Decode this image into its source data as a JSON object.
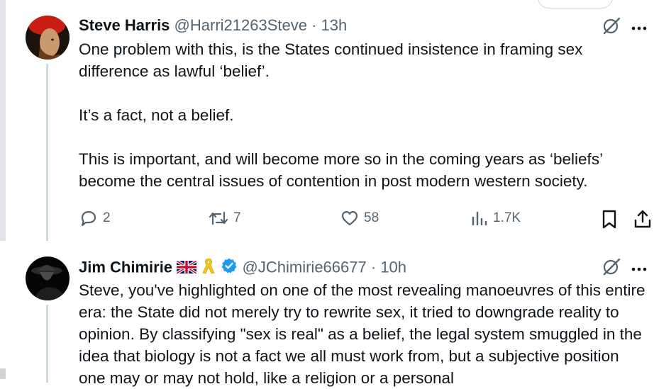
{
  "tweets": [
    {
      "name": "Steve Harris",
      "handle": "@Harri21263Steve",
      "separator": "·",
      "time": "13h",
      "text": "One problem with this, is the States continued insistence in framing sex difference as lawful ‘belief’.\n\nIt’s a fact, not a belief.\n\nThis is important, and will become more so in the coming years as ‘beliefs’ become the central issues of contention in post modern western society.",
      "replies": "2",
      "reposts": "7",
      "likes": "58",
      "views": "1.7K"
    },
    {
      "name": "Jim Chimirie",
      "handle": "@JChimirie66677",
      "separator": "·",
      "time": "10h",
      "text": "Steve, you've highlighted on one of the most revealing manoeuvres of this entire era: the State did not merely try to rewrite sex, it tried to downgrade reality to opinion. By classifying \"sex is real\" as a belief, the legal system smuggled in the idea that biology is not a fact we all must work from, but a subjective position one may or may not hold, like a religion or a personal"
    }
  ],
  "icons": {
    "grok": "grok-icon",
    "more": "more-icon",
    "reply": "reply-icon",
    "repost": "repost-icon",
    "like": "heart-icon",
    "views": "views-icon",
    "bookmark": "bookmark-icon",
    "share": "share-icon",
    "flag": "uk-flag-icon",
    "ribbon": "yellow-ribbon-icon",
    "verified": "verified-badge-icon"
  },
  "colors": {
    "text": "#0f1419",
    "secondary": "#536471",
    "verified": "#1d9bf0",
    "thread_line": "#cfd9de"
  }
}
